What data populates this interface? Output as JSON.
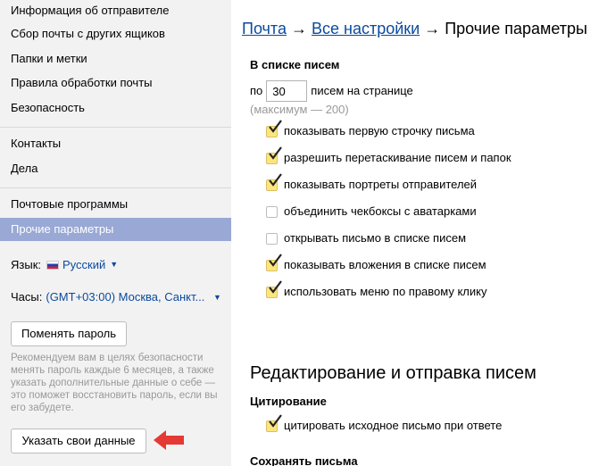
{
  "sidebar": {
    "items": [
      {
        "label": "Информация об отправителе"
      },
      {
        "label": "Сбор почты с других ящиков"
      },
      {
        "label": "Папки и метки"
      },
      {
        "label": "Правила обработки почты"
      },
      {
        "label": "Безопасность"
      },
      {
        "label": "Контакты"
      },
      {
        "label": "Дела"
      },
      {
        "label": "Почтовые программы"
      },
      {
        "label": "Прочие параметры",
        "active": true
      }
    ],
    "language": {
      "label": "Язык:",
      "value": "Русский"
    },
    "clock": {
      "label": "Часы:",
      "value": "(GMT+03:00) Москва, Санкт..."
    },
    "change_password_label": "Поменять пароль",
    "recommendation": "Рекомендуем вам в целях безопасности менять пароль каждые 6 месяцев, а также указать дополнительные данные о себе — это поможет восстановить пароль, если вы его забудете.",
    "specify_data_label": "Указать свои данные",
    "colors": {
      "active_bg": "#99a8d4",
      "arrow": "#e53935",
      "link": "#0b4a9e"
    }
  },
  "breadcrumb": {
    "mail": "Почта",
    "arrow": "→",
    "all_settings": "Все настройки",
    "current": "Прочие параметры"
  },
  "list_section": {
    "title": "В списке писем",
    "per_page_prefix": "по",
    "per_page_value": "30",
    "per_page_suffix": "писем на странице",
    "max_note": "(максимум — 200)",
    "options": [
      {
        "label": "показывать первую строчку письма",
        "checked": true
      },
      {
        "label": "разрешить перетаскивание писем и папок",
        "checked": true
      },
      {
        "label": "показывать портреты отправителей",
        "checked": true
      },
      {
        "label": "объединить чекбоксы с аватарками",
        "checked": false
      },
      {
        "label": "открывать письмо в списке писем",
        "checked": false
      },
      {
        "label": "показывать вложения в списке писем",
        "checked": true
      },
      {
        "label": "использовать меню по правому клику",
        "checked": true
      }
    ]
  },
  "edit_section": {
    "title": "Редактирование и отправка писем",
    "quoting_title": "Цитирование",
    "quoting_option": {
      "label": "цитировать исходное письмо при ответе",
      "checked": true
    },
    "save_title": "Сохранять письма"
  }
}
